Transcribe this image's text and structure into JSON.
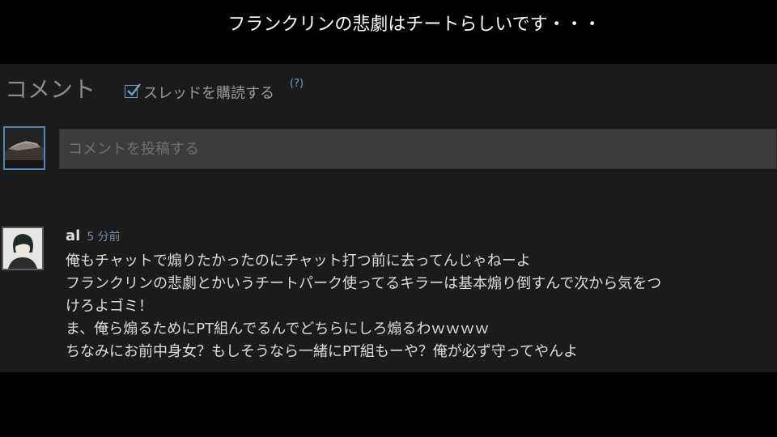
{
  "caption": "フランクリンの悲劇はチートらしいです・・・",
  "comments_section": {
    "title": "コメント",
    "subscribe_label": "スレッドを購読する",
    "subscribe_checked": true,
    "help_text": "(?)",
    "input_placeholder": "コメントを投稿する"
  },
  "comment": {
    "author": "al",
    "timestamp": "5 分前",
    "lines": [
      "俺もチャットで煽りたかったのにチャット打つ前に去ってんじゃねーよ",
      "フランクリンの悲劇とかいうチートパーク使ってるキラーは基本煽り倒すんで次から気をつ",
      "けろよゴミ！",
      "ま、俺ら煽るためにPT組んでるんでどちらにしろ煽るわｗｗｗｗ",
      "ちなみにお前中身女？もしそうなら一緒にPT組もーや？俺が必ず守ってやんよ"
    ]
  },
  "icons": {
    "my_avatar": "user-avatar-icon",
    "commenter_avatar": "commenter-avatar-icon",
    "checkbox": "checkmark-icon"
  },
  "colors": {
    "background": "#000000",
    "panel": "#1b1b1b",
    "input_background": "#3c3c3c",
    "accent": "#6aa0c8",
    "text": "#dcdcdc"
  }
}
